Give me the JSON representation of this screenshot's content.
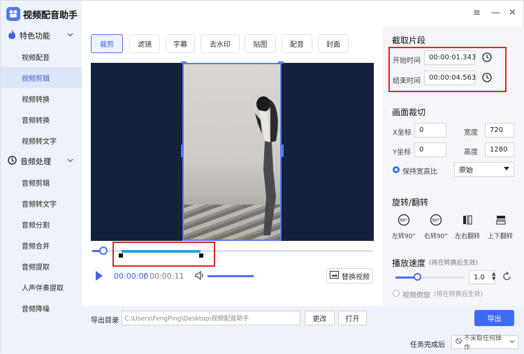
{
  "app": {
    "title": "视频配音助手",
    "accent": "#3f6af2"
  },
  "window_controls": [
    "≡",
    "—",
    "✕"
  ],
  "sidebar": {
    "group_video": "特色功能",
    "group_audio": "音频处理",
    "items": [
      "视频配音",
      "视频剪辑",
      "视频转换",
      "音频转换",
      "视频转文字",
      "音频剪辑",
      "音频转文字",
      "音频分割",
      "音频合并",
      "音频提取",
      "人声伴奏提取",
      "音频降噪"
    ],
    "active_item": "视频剪辑"
  },
  "tabs": [
    "裁剪",
    "滤镜",
    "字幕",
    "去水印",
    "贴图",
    "配音",
    "封面"
  ],
  "active_tab": "裁剪",
  "player": {
    "current_time": "00:00:00",
    "separator": "/",
    "total_time": "00:00:11",
    "replace_label": "替换视频"
  },
  "output": {
    "dir_label": "导出目录",
    "path": "C:\\Users\\FengPing\\Desktop\\视频配音助手",
    "change_label": "更改",
    "open_label": "打开",
    "export_label": "导出",
    "done_label": "任务完成后",
    "done_option": "不采取任何操作"
  },
  "clip": {
    "title": "截取片段",
    "start_label": "开始时间",
    "start_value": "00:00:01.343",
    "end_label": "结束时间",
    "end_value": "00:00:04.563"
  },
  "crop": {
    "title": "画面裁切",
    "x_label": "X坐标",
    "x_value": "0",
    "width_label": "宽度",
    "width_value": "720",
    "y_label": "Y坐标",
    "y_value": "0",
    "height_label": "高度",
    "height_value": "1280",
    "keep_ratio_label": "保持宽高比",
    "ratio_value": "原始"
  },
  "rotate": {
    "title": "旋转/翻转",
    "left_label": "左转90°",
    "right_label": "右转90°",
    "hflip_label": "左右翻转",
    "vflip_label": "上下翻转",
    "icon_text": "90°"
  },
  "speed": {
    "title": "播放速度",
    "note": "(将在转换后生效)",
    "value": "1.0",
    "level_fraction": 0.32,
    "reverse_label": "视频倒放",
    "reverse_note": "(将在转换后生效)"
  }
}
